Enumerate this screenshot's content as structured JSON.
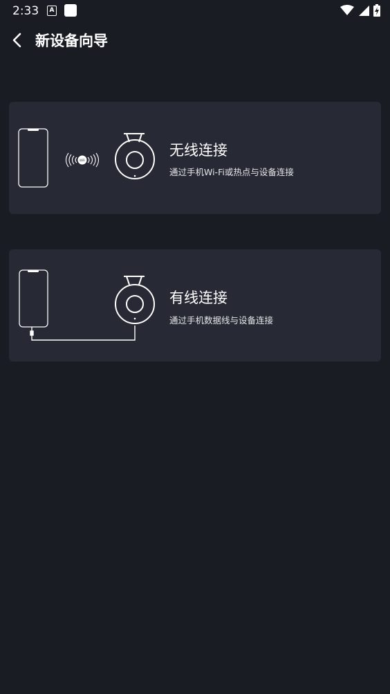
{
  "status_bar": {
    "time": "2:33",
    "notification_icon_letter": "A",
    "icons": [
      "wifi-signal-icon",
      "cell-signal-icon",
      "battery-charging-icon"
    ]
  },
  "header": {
    "back_icon": "chevron-left-icon",
    "title": "新设备向导"
  },
  "options": [
    {
      "title": "无线连接",
      "subtitle": "通过手机Wi-Fi或热点与设备连接",
      "illustration": "phone-wifi-camera",
      "wifi_badge": "WiFi"
    },
    {
      "title": "有线连接",
      "subtitle": "通过手机数据线与设备连接",
      "illustration": "phone-cable-camera"
    }
  ],
  "colors": {
    "background": "#1a1c24",
    "card": "#272a35",
    "text": "#ffffff"
  }
}
